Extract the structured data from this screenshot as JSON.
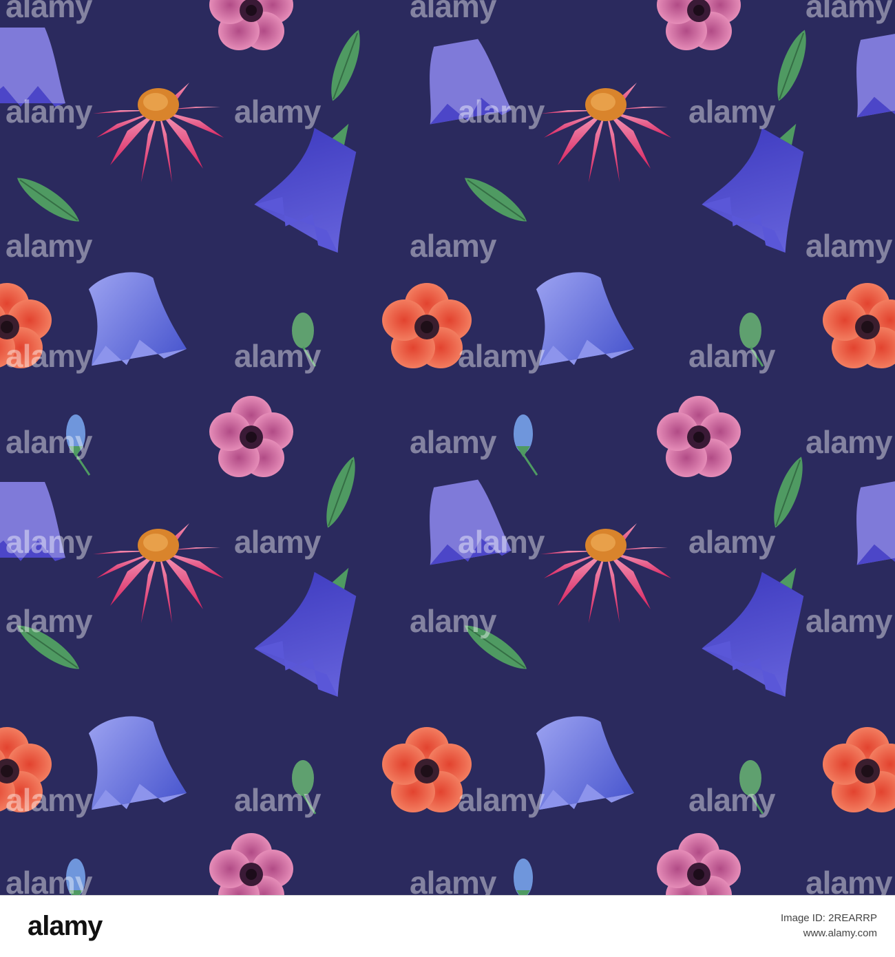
{
  "artwork": {
    "background": "#2b2a5e",
    "subject": "seamless watercolor wildflower pattern",
    "flower_kinds": [
      "bellflower",
      "echinacea",
      "poppy",
      "anemone",
      "bud",
      "leaf"
    ],
    "colors": {
      "bell_blue": "#4b46c4",
      "bell_violet": "#7b78d8",
      "echinacea": "#e23f7a",
      "echinacea_center": "#d9842c",
      "poppy": "#f26c4f",
      "anemone": "#e27aa9",
      "leaf": "#4f9a62"
    }
  },
  "watermark": {
    "text": "alamy"
  },
  "footer": {
    "logo": "alamy",
    "image_id_label": "Image ID: 2REARRP",
    "site": "www.alamy.com"
  }
}
